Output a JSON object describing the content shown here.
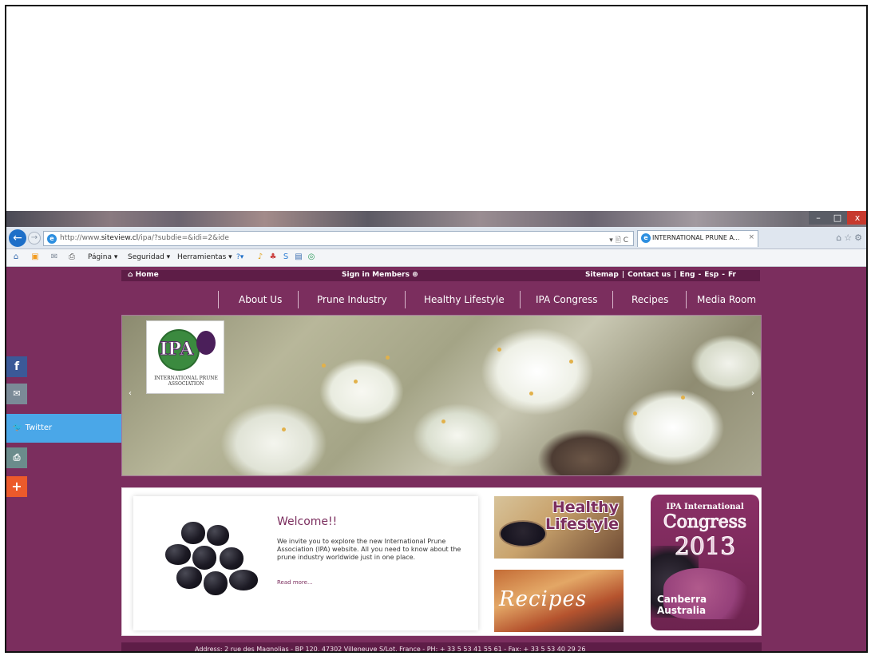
{
  "browser": {
    "url_prefix": "http://www.",
    "url_domain": "siteview.cl",
    "url_path": "/ipa/?subdie=&idi=2&ide",
    "address_tools": "▾ 🖹 C",
    "tab_title": "INTERNATIONAL PRUNE A...",
    "tab_close": "×",
    "window_minimize": "–",
    "window_maximize": "□",
    "window_close": "x",
    "back_arrow": "←",
    "forward_arrow": "→",
    "right_icons": "⌂☆⚙",
    "command_bar": {
      "page": "Página ▾",
      "security": "Seguridad ▾",
      "tools": "Herramientas ▾",
      "help": "?▾"
    }
  },
  "site": {
    "topbar": {
      "home": "Home",
      "sign_in": "Sign in Members",
      "sitemap": "Sitemap",
      "contact": "Contact us",
      "lang_eng": "Eng",
      "lang_esp": "Esp",
      "lang_fr": "Fr",
      "sep": "|",
      "lang_sep": "-"
    },
    "nav": [
      "About Us",
      "Prune Industry",
      "Healthy Lifestyle",
      "IPA Congress",
      "Recipes",
      "Media Room"
    ],
    "logo": {
      "text": "IPA",
      "caption": "INTERNATIONAL PRUNE ASSOCIATION"
    },
    "slider_prev": "‹",
    "slider_next": "›",
    "welcome": {
      "title": "Welcome!!",
      "body": "We invite you to explore the new International Prune Association (IPA) website. All you need to know about the prune industry worldwide just in one place.",
      "read_more": "Read more..."
    },
    "promos": {
      "healthy": "Healthy Lifestyle",
      "recipes": "Recipes",
      "congress_small": "IPA International",
      "congress_big": "Congress",
      "congress_year": "2013",
      "congress_city": "Canberra",
      "congress_country": "Australia"
    },
    "footer": "Address: 2 rue des Magnolias - BP 120, 47302 Villeneuve S/Lot, France - PH: + 33 5 53 41 55 61 - Fax: + 33 5 53 40 29 26"
  },
  "share": {
    "facebook": "f",
    "email": "✉",
    "twitter_icon": "🐦",
    "twitter": "Twitter",
    "print": "⎙",
    "add": "+"
  }
}
